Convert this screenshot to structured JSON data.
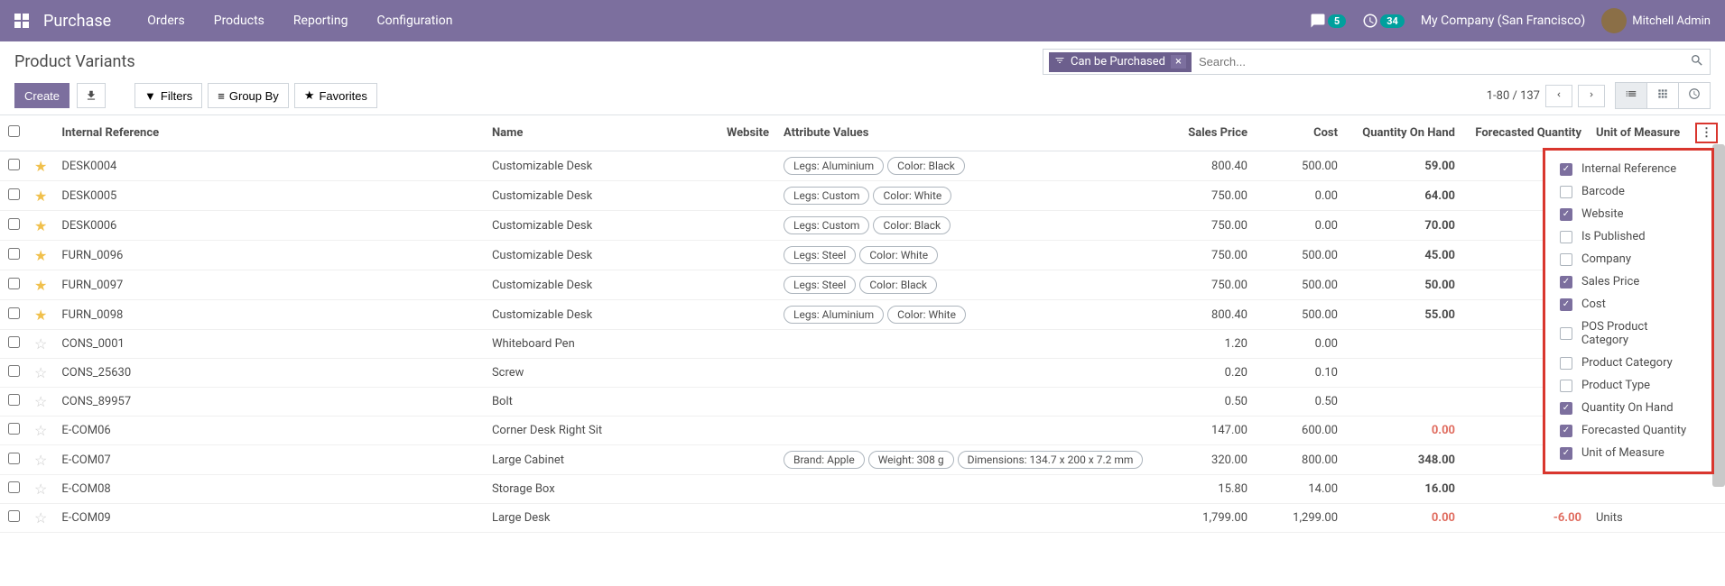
{
  "nav": {
    "brand": "Purchase",
    "links": [
      "Orders",
      "Products",
      "Reporting",
      "Configuration"
    ],
    "chat_count": "5",
    "activity_count": "34",
    "company": "My Company (San Francisco)",
    "user": "Mitchell Admin"
  },
  "cp": {
    "title": "Product Variants",
    "create": "Create",
    "filter_chip": "Can be Purchased",
    "search_placeholder": "Search...",
    "filters": "Filters",
    "groupby": "Group By",
    "favorites": "Favorites",
    "pager": "1-80 / 137"
  },
  "columns": {
    "ref": "Internal Reference",
    "name": "Name",
    "website": "Website",
    "attrs": "Attribute Values",
    "price": "Sales Price",
    "cost": "Cost",
    "qty": "Quantity On Hand",
    "forecast": "Forecasted Quantity",
    "uom": "Unit of Measure"
  },
  "rows": [
    {
      "fav": true,
      "ref": "DESK0004",
      "name": "Customizable Desk",
      "attrs": [
        "Legs: Aluminium",
        "Color: Black"
      ],
      "price": "800.40",
      "cost": "500.00",
      "qty": "59.00",
      "forecast": "",
      "uom": "",
      "red": false
    },
    {
      "fav": true,
      "ref": "DESK0005",
      "name": "Customizable Desk",
      "attrs": [
        "Legs: Custom",
        "Color: White"
      ],
      "price": "750.00",
      "cost": "0.00",
      "qty": "64.00",
      "forecast": "",
      "uom": "",
      "red": false
    },
    {
      "fav": true,
      "ref": "DESK0006",
      "name": "Customizable Desk",
      "attrs": [
        "Legs: Custom",
        "Color: Black"
      ],
      "price": "750.00",
      "cost": "0.00",
      "qty": "70.00",
      "forecast": "",
      "uom": "",
      "red": false
    },
    {
      "fav": true,
      "ref": "FURN_0096",
      "name": "Customizable Desk",
      "attrs": [
        "Legs: Steel",
        "Color: White"
      ],
      "price": "750.00",
      "cost": "500.00",
      "qty": "45.00",
      "forecast": "",
      "uom": "",
      "red": false
    },
    {
      "fav": true,
      "ref": "FURN_0097",
      "name": "Customizable Desk",
      "attrs": [
        "Legs: Steel",
        "Color: Black"
      ],
      "price": "750.00",
      "cost": "500.00",
      "qty": "50.00",
      "forecast": "",
      "uom": "",
      "red": false
    },
    {
      "fav": true,
      "ref": "FURN_0098",
      "name": "Customizable Desk",
      "attrs": [
        "Legs: Aluminium",
        "Color: White"
      ],
      "price": "800.40",
      "cost": "500.00",
      "qty": "55.00",
      "forecast": "",
      "uom": "",
      "red": false
    },
    {
      "fav": false,
      "ref": "CONS_0001",
      "name": "Whiteboard Pen",
      "attrs": [],
      "price": "1.20",
      "cost": "0.00",
      "qty": "",
      "forecast": "",
      "uom": "",
      "red": false
    },
    {
      "fav": false,
      "ref": "CONS_25630",
      "name": "Screw",
      "attrs": [],
      "price": "0.20",
      "cost": "0.10",
      "qty": "",
      "forecast": "",
      "uom": "",
      "red": false
    },
    {
      "fav": false,
      "ref": "CONS_89957",
      "name": "Bolt",
      "attrs": [],
      "price": "0.50",
      "cost": "0.50",
      "qty": "",
      "forecast": "",
      "uom": "",
      "red": false
    },
    {
      "fav": false,
      "ref": "E-COM06",
      "name": "Corner Desk Right Sit",
      "attrs": [],
      "price": "147.00",
      "cost": "600.00",
      "qty": "0.00",
      "forecast": "",
      "uom": "",
      "red": true
    },
    {
      "fav": false,
      "ref": "E-COM07",
      "name": "Large Cabinet",
      "attrs": [
        "Brand: Apple",
        "Weight: 308 g",
        "Dimensions: 134.7 x 200 x 7.2 mm"
      ],
      "price": "320.00",
      "cost": "800.00",
      "qty": "348.00",
      "forecast": "",
      "uom": "",
      "red": false
    },
    {
      "fav": false,
      "ref": "E-COM08",
      "name": "Storage Box",
      "attrs": [],
      "price": "15.80",
      "cost": "14.00",
      "qty": "16.00",
      "forecast": "",
      "uom": "",
      "red": false
    },
    {
      "fav": false,
      "ref": "E-COM09",
      "name": "Large Desk",
      "attrs": [],
      "price": "1,799.00",
      "cost": "1,299.00",
      "qty": "0.00",
      "forecast": "-6.00",
      "uom": "Units",
      "red": true
    }
  ],
  "dropdown": [
    {
      "label": "Internal Reference",
      "on": true
    },
    {
      "label": "Barcode",
      "on": false
    },
    {
      "label": "Website",
      "on": true
    },
    {
      "label": "Is Published",
      "on": false
    },
    {
      "label": "Company",
      "on": false
    },
    {
      "label": "Sales Price",
      "on": true
    },
    {
      "label": "Cost",
      "on": true
    },
    {
      "label": "POS Product Category",
      "on": false
    },
    {
      "label": "Product Category",
      "on": false
    },
    {
      "label": "Product Type",
      "on": false
    },
    {
      "label": "Quantity On Hand",
      "on": true
    },
    {
      "label": "Forecasted Quantity",
      "on": true
    },
    {
      "label": "Unit of Measure",
      "on": true
    }
  ]
}
